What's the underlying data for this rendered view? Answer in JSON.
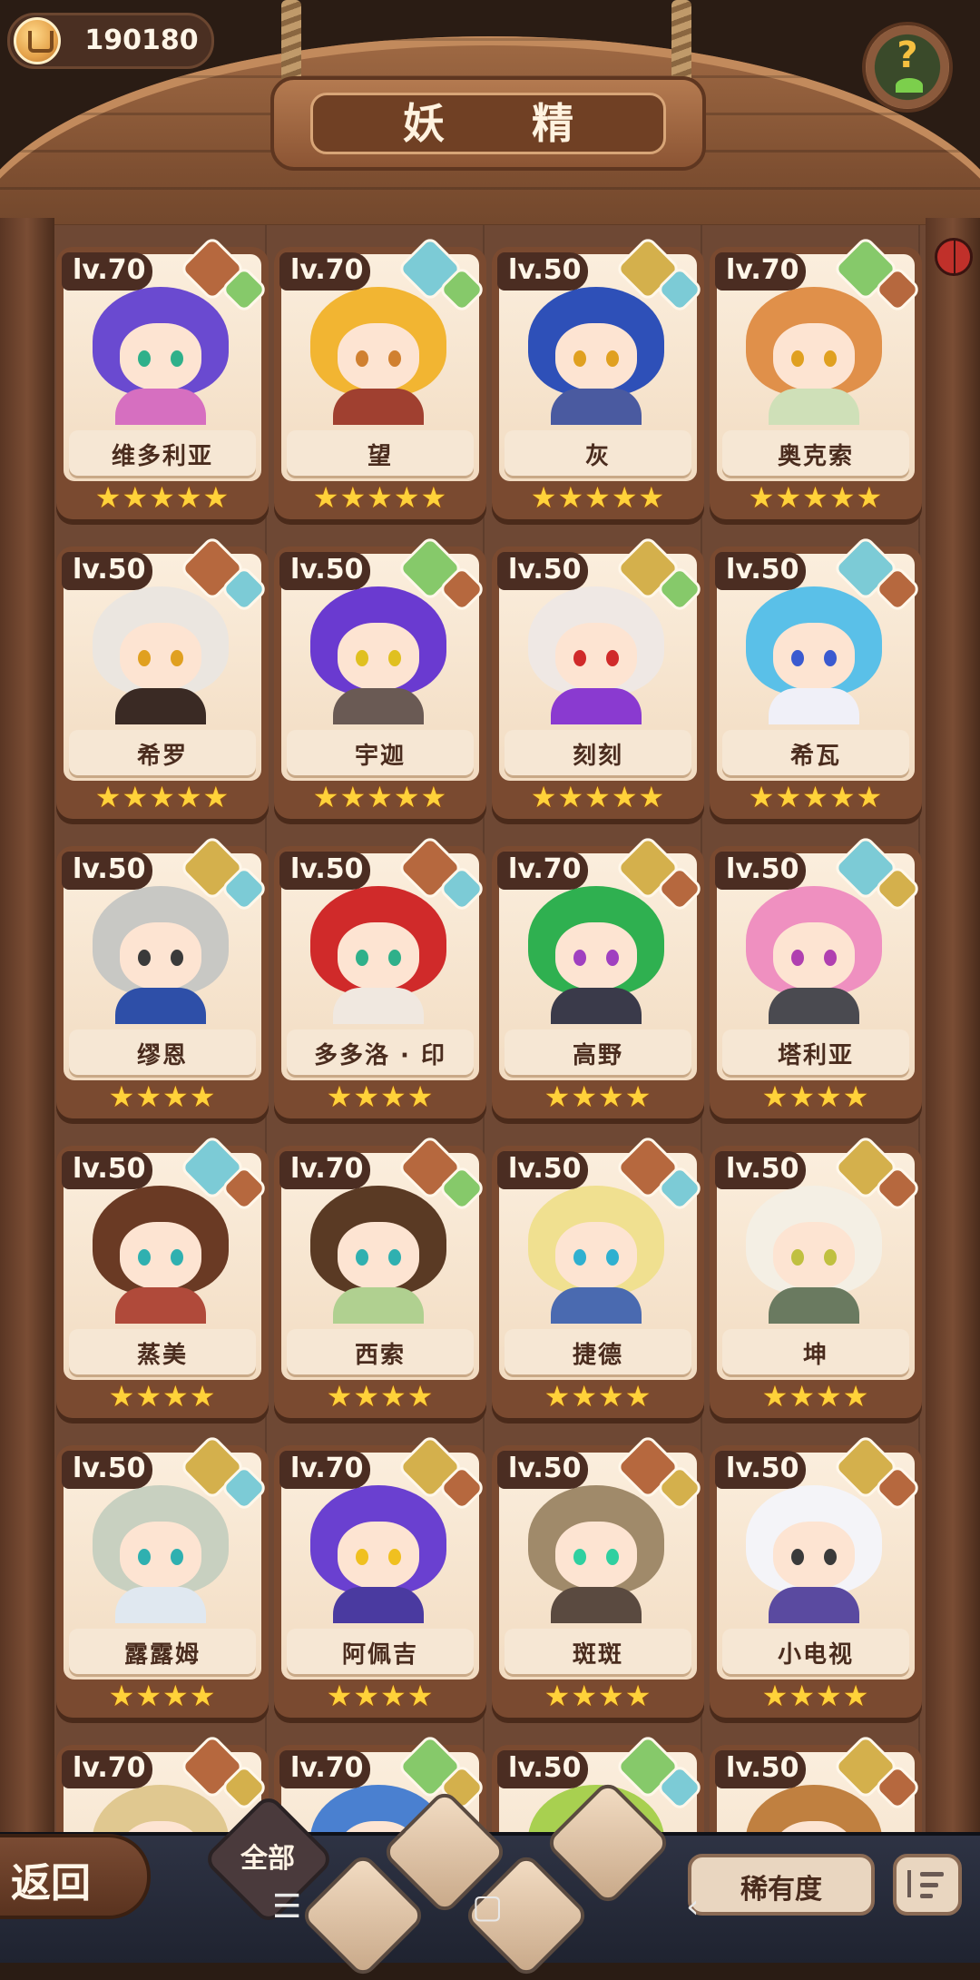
{
  "currency": {
    "value": "190180",
    "icon": "coin-icon"
  },
  "header": {
    "title": "妖 精",
    "help_icon": "help-icon"
  },
  "colors": {
    "wood": "#7e4f31",
    "card_bg": "#7a4a30",
    "paper": "#fbeedd",
    "star": "#ffd23a"
  },
  "cards": [
    {
      "level": "lv.70",
      "name": "维多利亚",
      "stars": "★★★★★",
      "gem1": "earth",
      "gem2": "leaf",
      "hair": "#6a4ad0",
      "eye": "#2fb08a",
      "body": "#d66fc0"
    },
    {
      "level": "lv.70",
      "name": "望",
      "stars": "★★★★★",
      "gem1": "water",
      "gem2": "leaf",
      "hair": "#f2b532",
      "eye": "#d08030",
      "body": "#a04030"
    },
    {
      "level": "lv.50",
      "name": "灰",
      "stars": "★★★★★",
      "gem1": "sand",
      "gem2": "water",
      "hair": "#2e50b8",
      "eye": "#e0a020",
      "body": "#4a5aa0"
    },
    {
      "level": "lv.70",
      "name": "奥克索",
      "stars": "★★★★★",
      "gem1": "leaf",
      "gem2": "earth",
      "hair": "#e0904a",
      "eye": "#e0a020",
      "body": "#cfe0b8"
    },
    {
      "level": "lv.50",
      "name": "希罗",
      "stars": "★★★★★",
      "gem1": "earth",
      "gem2": "water",
      "hair": "#ebe6e0",
      "eye": "#e0a020",
      "body": "#3a2a24"
    },
    {
      "level": "lv.50",
      "name": "宇迦",
      "stars": "★★★★★",
      "gem1": "leaf",
      "gem2": "earth",
      "hair": "#6a3ad0",
      "eye": "#e0c020",
      "body": "#6a5a54"
    },
    {
      "level": "lv.50",
      "name": "刻刻",
      "stars": "★★★★★",
      "gem1": "sand",
      "gem2": "leaf",
      "hair": "#efe8e4",
      "eye": "#d02a2a",
      "body": "#8a3ad0"
    },
    {
      "level": "lv.50",
      "name": "希瓦",
      "stars": "★★★★★",
      "gem1": "water",
      "gem2": "earth",
      "hair": "#5ac0e8",
      "eye": "#3a5ad0",
      "body": "#f0f0f8"
    },
    {
      "level": "lv.50",
      "name": "缪恩",
      "stars": "★★★★",
      "gem1": "sand",
      "gem2": "water",
      "hair": "#c8c8c4",
      "eye": "#3a3a3a",
      "body": "#2e4fa8"
    },
    {
      "level": "lv.50",
      "name": "多多洛 · 印",
      "stars": "★★★★",
      "gem1": "earth",
      "gem2": "water",
      "hair": "#d02a2a",
      "eye": "#2fb08a",
      "body": "#f0e8e0"
    },
    {
      "level": "lv.70",
      "name": "高野",
      "stars": "★★★★",
      "gem1": "sand",
      "gem2": "earth",
      "hair": "#2fb050",
      "eye": "#a040c0",
      "body": "#3a3a4a"
    },
    {
      "level": "lv.50",
      "name": "塔利亚",
      "stars": "★★★★",
      "gem1": "water",
      "gem2": "sand",
      "hair": "#ef90c0",
      "eye": "#b040b0",
      "body": "#4a4a50"
    },
    {
      "level": "lv.50",
      "name": "蒸美",
      "stars": "★★★★",
      "gem1": "water",
      "gem2": "earth",
      "hair": "#6a3a24",
      "eye": "#2fb0b0",
      "body": "#b04a3a"
    },
    {
      "level": "lv.70",
      "name": "西索",
      "stars": "★★★★",
      "gem1": "earth",
      "gem2": "leaf",
      "hair": "#5a3a24",
      "eye": "#2fb0b0",
      "body": "#b0d090"
    },
    {
      "level": "lv.50",
      "name": "捷德",
      "stars": "★★★★",
      "gem1": "earth",
      "gem2": "water",
      "hair": "#f0e090",
      "eye": "#2fb0d0",
      "body": "#4a6ab0"
    },
    {
      "level": "lv.50",
      "name": "坤",
      "stars": "★★★★",
      "gem1": "sand",
      "gem2": "earth",
      "hair": "#f4efe4",
      "eye": "#c0c040",
      "body": "#6a7a60"
    },
    {
      "level": "lv.50",
      "name": "露露姆",
      "stars": "★★★★",
      "gem1": "sand",
      "gem2": "water",
      "hair": "#c8d0c0",
      "eye": "#2fb0b0",
      "body": "#e0e8f0"
    },
    {
      "level": "lv.70",
      "name": "阿佩吉",
      "stars": "★★★★",
      "gem1": "sand",
      "gem2": "earth",
      "hair": "#6a40d0",
      "eye": "#f0c020",
      "body": "#4a3aa0"
    },
    {
      "level": "lv.50",
      "name": "斑斑",
      "stars": "★★★★",
      "gem1": "earth",
      "gem2": "sand",
      "hair": "#a08a6a",
      "eye": "#2fd0a0",
      "body": "#5a4a40"
    },
    {
      "level": "lv.50",
      "name": "小电视",
      "stars": "★★★★",
      "gem1": "sand",
      "gem2": "earth",
      "hair": "#f4f4f8",
      "eye": "#3a3a3a",
      "body": "#5a4aa0"
    },
    {
      "level": "lv.70",
      "name": "",
      "stars": "",
      "gem1": "earth",
      "gem2": "sand",
      "hair": "#e0c890",
      "eye": "#3a3a3a",
      "body": "#c0a070"
    },
    {
      "level": "lv.70",
      "name": "",
      "stars": "",
      "gem1": "leaf",
      "gem2": "sand",
      "hair": "#4a80d0",
      "eye": "#3a3a3a",
      "body": "#5a80c0"
    },
    {
      "level": "lv.50",
      "name": "",
      "stars": "",
      "gem1": "leaf",
      "gem2": "water",
      "hair": "#a8d050",
      "eye": "#3a3a3a",
      "body": "#90c050"
    },
    {
      "level": "lv.50",
      "name": "",
      "stars": "",
      "gem1": "sand",
      "gem2": "earth",
      "hair": "#c08040",
      "eye": "#3a3a3a",
      "body": "#60c0b0"
    }
  ],
  "bottom": {
    "back_label": "返回",
    "filter_all_label": "全部",
    "filters": [
      "sprout-filter",
      "water-filter",
      "earth-filter",
      "crystal-filter"
    ],
    "sort_label": "稀有度",
    "order_icon": "sort-order-icon"
  }
}
